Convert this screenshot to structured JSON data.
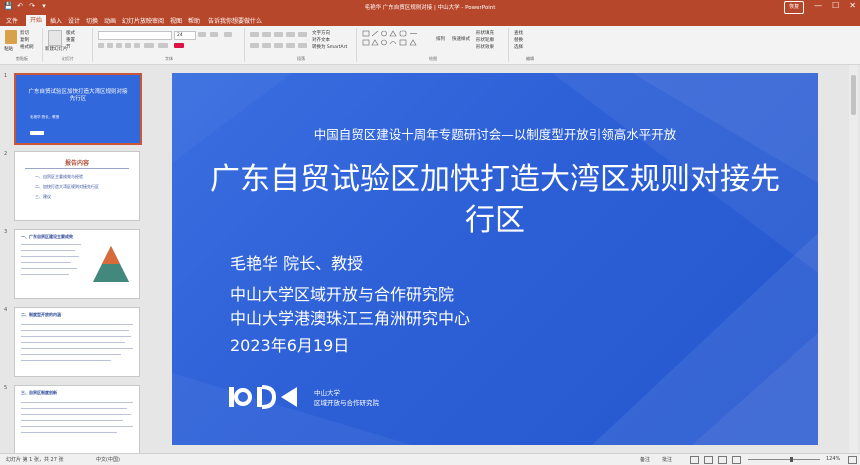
{
  "window": {
    "title": "毛艳华 广东自贸区规则对接 | 中山大学 - PowerPoint",
    "minimize": "—",
    "maximize": "☐",
    "close": "✕",
    "restore_label": "恢复"
  },
  "quick_access": [
    "💾",
    "↶",
    "↷",
    "▾"
  ],
  "ribbon_tabs": [
    "文件",
    "开始",
    "插入",
    "设计",
    "切换",
    "动画",
    "幻灯片放映",
    "审阅",
    "视图",
    "帮助",
    "告诉我你想要做什么"
  ],
  "active_tab": "开始",
  "ribbon": {
    "clipboard_label": "剪贴板",
    "paste": "粘贴",
    "cut": "剪切",
    "copy": "复制",
    "format_painter": "格式刷",
    "slides_label": "幻灯片",
    "new_slide": "新建幻灯片",
    "layout": "版式",
    "reset": "重置",
    "section": "节",
    "font_label": "字体",
    "font_size": "24",
    "paragraph_label": "段落",
    "text_direction": "文字方向",
    "align_text": "对齐文本",
    "smartart": "转换为 SmartArt",
    "drawing_label": "绘图",
    "arrange": "排列",
    "quick_styles": "快速样式",
    "shape_fill": "形状填充",
    "shape_outline": "形状轮廓",
    "shape_effects": "形状效果",
    "editing_label": "编辑",
    "find": "查找",
    "replace": "替换",
    "select": "选择"
  },
  "thumbnails": [
    {
      "num": "1",
      "title": "广东自贸试验区加快打造大湾区规则对接先行区",
      "sub": "毛艳华 院长、教授"
    },
    {
      "num": "2",
      "title": "报告内容",
      "items": [
        "一、自贸区主要成效与经验",
        "二、加快打造大湾区规则对接先行区",
        "三、建议"
      ]
    },
    {
      "num": "3",
      "title": "一、广东自贸区建设主要成效"
    },
    {
      "num": "4",
      "title": "二、制度型开放的内涵"
    },
    {
      "num": "5",
      "title": "三、自贸区制度创新"
    }
  ],
  "slide": {
    "subtitle": "中国自贸区建设十周年专题研讨会—以制度型开放引领高水平开放",
    "title": "广东自贸试验区加快打造大湾区规则对接先行区",
    "presenter": "毛艳华  院长、教授",
    "org1": "中山大学区域开放与合作研究院",
    "org2": "中山大学港澳珠江三角洲研究中心",
    "date": "2023年6月19日",
    "logo_line1": "中山大学",
    "logo_line2": "区域开放与合作研究院"
  },
  "status": {
    "slide_pos": "幻灯片 第 1 张，共 27 张",
    "lang": "中文(中国)",
    "notes": "备注",
    "comments": "批注",
    "zoom": "124%"
  },
  "colors": {
    "accent": "#b7472a",
    "slide_blue": "#2d5fd6"
  }
}
